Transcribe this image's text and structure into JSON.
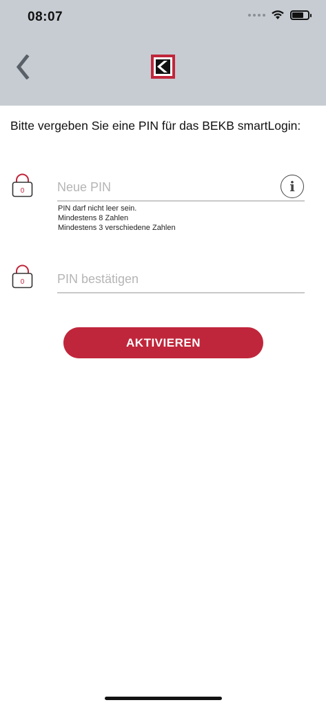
{
  "status_bar": {
    "time": "08:07",
    "battery_level": 0.72
  },
  "nav": {
    "back_icon": "chevron-left-icon",
    "logo": "bekb-logo",
    "brand_color": "#c0263b"
  },
  "intro_text": "Bitte vergeben Sie eine PIN für das BEKB smartLogin:",
  "pin_field": {
    "placeholder": "Neue PIN",
    "value": "",
    "info_icon": "info-icon",
    "hints": [
      "PIN darf nicht leer sein.",
      "Mindestens 8 Zahlen",
      "Mindestens 3 verschiedene Zahlen"
    ]
  },
  "confirm_field": {
    "placeholder": "PIN bestätigen",
    "value": ""
  },
  "lock_icon_digit": "0",
  "activate_label": "AKTIVIEREN",
  "colors": {
    "header_bg": "#c7ccd2",
    "accent": "#c0263b",
    "underline": "#c9c9c9"
  }
}
